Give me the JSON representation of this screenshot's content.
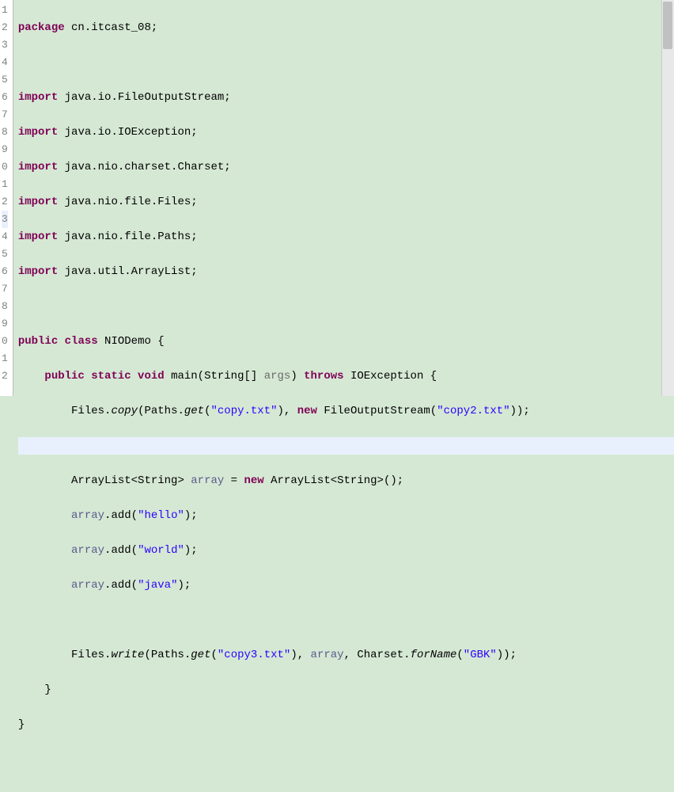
{
  "gutter": [
    "1",
    "2",
    "3",
    "4",
    "5",
    "6",
    "7",
    "8",
    "9",
    "0",
    "1",
    "2",
    "3",
    "4",
    "5",
    "6",
    "7",
    "8",
    "9",
    "0",
    "1",
    "2"
  ],
  "code": {
    "l1": {
      "kw1": "package",
      "pkg": " cn.itcast_08;"
    },
    "l3": {
      "kw": "import",
      "rest": " java.io.FileOutputStream;"
    },
    "l4": {
      "kw": "import",
      "rest": " java.io.IOException;"
    },
    "l5": {
      "kw": "import",
      "rest": " java.nio.charset.Charset;"
    },
    "l6": {
      "kw": "import",
      "rest": " java.nio.file.Files;"
    },
    "l7": {
      "kw": "import",
      "rest": " java.nio.file.Paths;"
    },
    "l8": {
      "kw": "import",
      "rest": " java.util.ArrayList;"
    },
    "l10": {
      "kw1": "public",
      "kw2": " class",
      "name": " NIODemo {"
    },
    "l11": {
      "indent": "    ",
      "kw1": "public",
      "kw2": " static",
      "kw3": " void",
      "name": " main(String[] ",
      "param": "args",
      "paren": ") ",
      "kw4": "throws",
      "exc": " IOException {"
    },
    "l12": {
      "indent": "        ",
      "pre": "Files.",
      "call": "copy",
      "mid1": "(Paths.",
      "call2": "get",
      "open": "(",
      "str1": "\"copy.txt\"",
      "mid2": "), ",
      "kw": "new",
      "mid3": " FileOutputStream(",
      "str2": "\"copy2.txt\"",
      "end": "));"
    },
    "l14": {
      "indent": "        ",
      "pre": "ArrayList<String> ",
      "var": "array",
      "mid": " = ",
      "kw": "new",
      "rest": " ArrayList<String>();"
    },
    "l15": {
      "indent": "        ",
      "var": "array",
      "mid": ".add(",
      "str": "\"hello\"",
      "end": ");"
    },
    "l16": {
      "indent": "        ",
      "var": "array",
      "mid": ".add(",
      "str": "\"world\"",
      "end": ");"
    },
    "l17": {
      "indent": "        ",
      "var": "array",
      "mid": ".add(",
      "str": "\"java\"",
      "end": ");"
    },
    "l19": {
      "indent": "        ",
      "pre": "Files.",
      "call": "write",
      "mid1": "(Paths.",
      "call2": "get",
      "open": "(",
      "str1": "\"copy3.txt\"",
      "mid2": "), ",
      "var": "array",
      "mid3": ", Charset.",
      "call3": "forName",
      "open2": "(",
      "str2": "\"GBK\"",
      "end": "));"
    },
    "l20": {
      "indent": "    ",
      "brace": "}"
    },
    "l21": {
      "brace": "}"
    }
  }
}
